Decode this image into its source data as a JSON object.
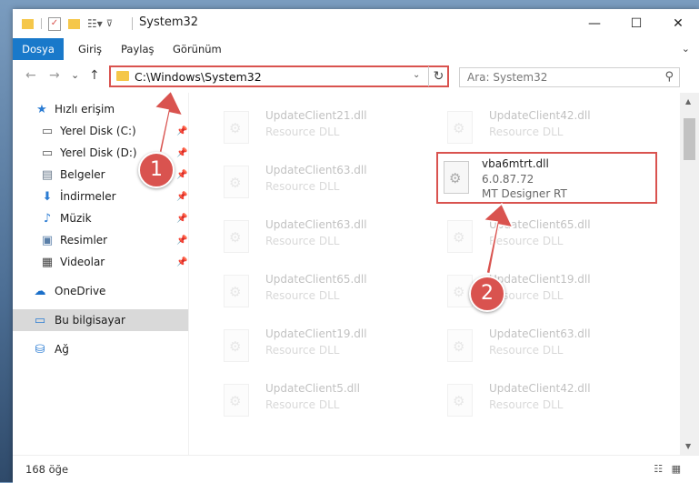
{
  "window": {
    "title": "System32",
    "controls": {
      "minimize": "—",
      "maximize": "☐",
      "close": "✕"
    }
  },
  "ribbon": {
    "tabs": [
      "Dosya",
      "Giriş",
      "Paylaş",
      "Görünüm"
    ]
  },
  "nav": {
    "back": "←",
    "forward": "→",
    "recent": "⌄",
    "up": "↑"
  },
  "address": {
    "path": "C:\\Windows\\System32"
  },
  "search": {
    "placeholder": "Ara: System32"
  },
  "sidebar": {
    "items": [
      {
        "label": "Hızlı erişim",
        "icon": "star-icon",
        "glyph": "★",
        "color": "#2b7cd3"
      },
      {
        "label": "Yerel Disk (C:)",
        "icon": "drive-icon",
        "glyph": "▭",
        "color": "#555555"
      },
      {
        "label": "Yerel Disk (D:)",
        "icon": "drive-icon",
        "glyph": "▭",
        "color": "#555555"
      },
      {
        "label": "Belgeler",
        "icon": "documents-icon",
        "glyph": "▤",
        "color": "#6b7b8c"
      },
      {
        "label": "İndirmeler",
        "icon": "download-icon",
        "glyph": "⬇",
        "color": "#2b7cd3"
      },
      {
        "label": "Müzik",
        "icon": "music-icon",
        "glyph": "♪",
        "color": "#2b7cd3"
      },
      {
        "label": "Resimler",
        "icon": "pictures-icon",
        "glyph": "▣",
        "color": "#5a7fa8"
      },
      {
        "label": "Videolar",
        "icon": "video-icon",
        "glyph": "▦",
        "color": "#444444"
      },
      {
        "label": "OneDrive",
        "icon": "cloud-icon",
        "glyph": "☁",
        "color": "#1a6fc9"
      },
      {
        "label": "Bu bilgisayar",
        "icon": "computer-icon",
        "glyph": "▭",
        "color": "#2b7cd3"
      },
      {
        "label": "Ağ",
        "icon": "network-icon",
        "glyph": "⛁",
        "color": "#2b7cd3"
      }
    ]
  },
  "files": [
    {
      "name": "UpdateClient21.dll",
      "type": "Resource DLL"
    },
    {
      "name": "UpdateClient42.dll",
      "type": "Resource DLL"
    },
    {
      "name": "UpdateClient63.dll",
      "type": "Resource DLL"
    },
    {
      "name": "vba6mtrt.dll",
      "version": "6.0.87.72",
      "company": "MT Designer RT"
    },
    {
      "name": "UpdateClient63.dll",
      "type": "Resource DLL"
    },
    {
      "name": "UpdateClient65.dll",
      "type": "Resource DLL"
    },
    {
      "name": "UpdateClient65.dll",
      "type": "Resource DLL"
    },
    {
      "name": "UpdateClient19.dll",
      "type": "Resource DLL"
    },
    {
      "name": "UpdateClient19.dll",
      "type": "Resource DLL"
    },
    {
      "name": "UpdateClient63.dll",
      "type": "Resource DLL"
    },
    {
      "name": "UpdateClient5.dll",
      "type": "Resource DLL"
    },
    {
      "name": "UpdateClient42.dll",
      "type": "Resource DLL"
    }
  ],
  "status": {
    "count": "168 öğe"
  },
  "annotations": {
    "step1": "1",
    "step2": "2",
    "color": "#d9534f"
  }
}
